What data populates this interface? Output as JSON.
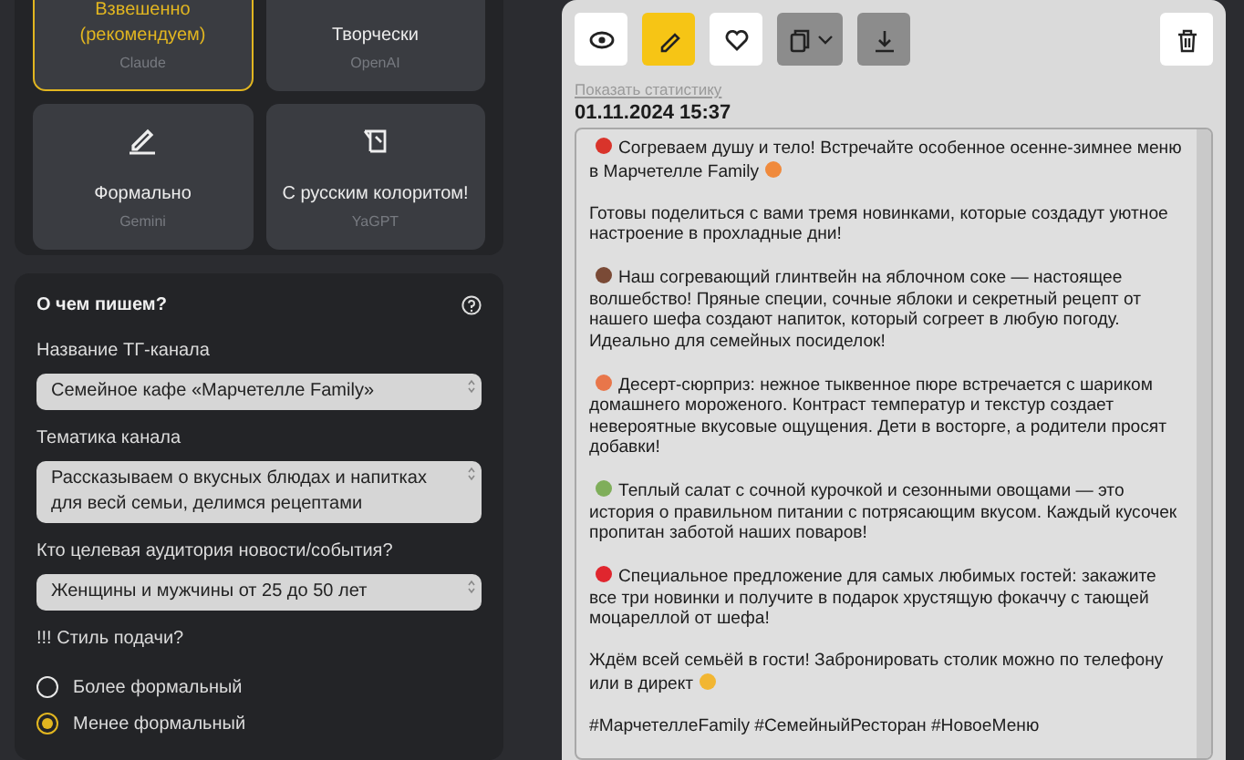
{
  "style_cards": [
    {
      "title": "Взвешенно (рекомендуем)",
      "model": "Claude",
      "selected": true,
      "kind": "plain"
    },
    {
      "title": "Творчески",
      "model": "OpenAI",
      "selected": false,
      "kind": "plain"
    },
    {
      "title": "Формально",
      "model": "Gemini",
      "selected": false,
      "kind": "pen"
    },
    {
      "title": "С русским колоритом!",
      "model": "YaGPT",
      "selected": false,
      "kind": "scroll"
    }
  ],
  "form": {
    "title": "О чем пишем?",
    "fields": [
      {
        "label": "Название ТГ-канала",
        "value": "Семейное кафе «Марчетелле Family»"
      },
      {
        "label": "Тематика канала",
        "value": "Рассказываем о вкусных блюдах  и напитках для весй семьи, делимся рецептами"
      },
      {
        "label": "Кто целевая аудитория новости/события?",
        "value": "Женщины и мужчины от 25 до 50 лет"
      }
    ],
    "style_question": "!!! Стиль подачи?",
    "options": [
      {
        "label": "Более формальный",
        "selected": false
      },
      {
        "label": "Менее формальный",
        "selected": true
      }
    ]
  },
  "post": {
    "toolbar": [
      {
        "kind": "view",
        "active": false
      },
      {
        "kind": "edit",
        "active": true
      },
      {
        "kind": "like",
        "active": false
      },
      {
        "kind": "copy",
        "active": false
      },
      {
        "kind": "download",
        "active": false
      },
      {
        "kind": "delete",
        "active": false
      }
    ],
    "stats_link": "Показать статистику",
    "date": "01.11.2024 15:37",
    "paragraphs": [
      {
        "text": "Согреваем душу и тело! Встречайте особенное осенне-зимнее меню в Марчетелле Family",
        "color": "#d9342b",
        "trailing_emoji": {
          "color": "#f08a3c"
        }
      },
      {
        "text": "Готовы поделиться с вами тремя новинками, которые создадут уютное настроение в прохладные дни!"
      },
      {
        "text": "Наш согревающий глинтвейн на яблочном соке — настоящее волшебство! Пряные специи, сочные яблоки и секретный рецепт от нашего шефа создают напиток, который согреет в любую погоду. Идеально для семейных посиделок!",
        "color": "#7a4a36"
      },
      {
        "text": "Десерт-сюрприз: нежное тыквенное пюре встречается с шариком домашнего мороженого. Контраст температур и текстур создает невероятные вкусовые ощущения. Дети в восторге, а родители просят добавки!",
        "color": "#e8764a"
      },
      {
        "text": "Теплый салат с сочной курочкой и сезонными овощами — это история о правильном питании с потрясающим вкусом. Каждый кусочек пропитан заботой наших поваров!",
        "color": "#7fae5a"
      },
      {
        "text": "Специальное предложение для самых любимых гостей: закажите все три новинки и получите в подарок хрустящую фокаччу с тающей моцареллой от шефа!",
        "color": "#e0262e"
      },
      {
        "text": "Ждём всей семьёй в гости! Забронировать столик можно по телефону или в директ",
        "trailing_emoji": {
          "color": "#f2b632"
        }
      },
      {
        "text": "#МарчетеллеFamily #СемейныйРесторан #НовоеМеню"
      }
    ]
  }
}
